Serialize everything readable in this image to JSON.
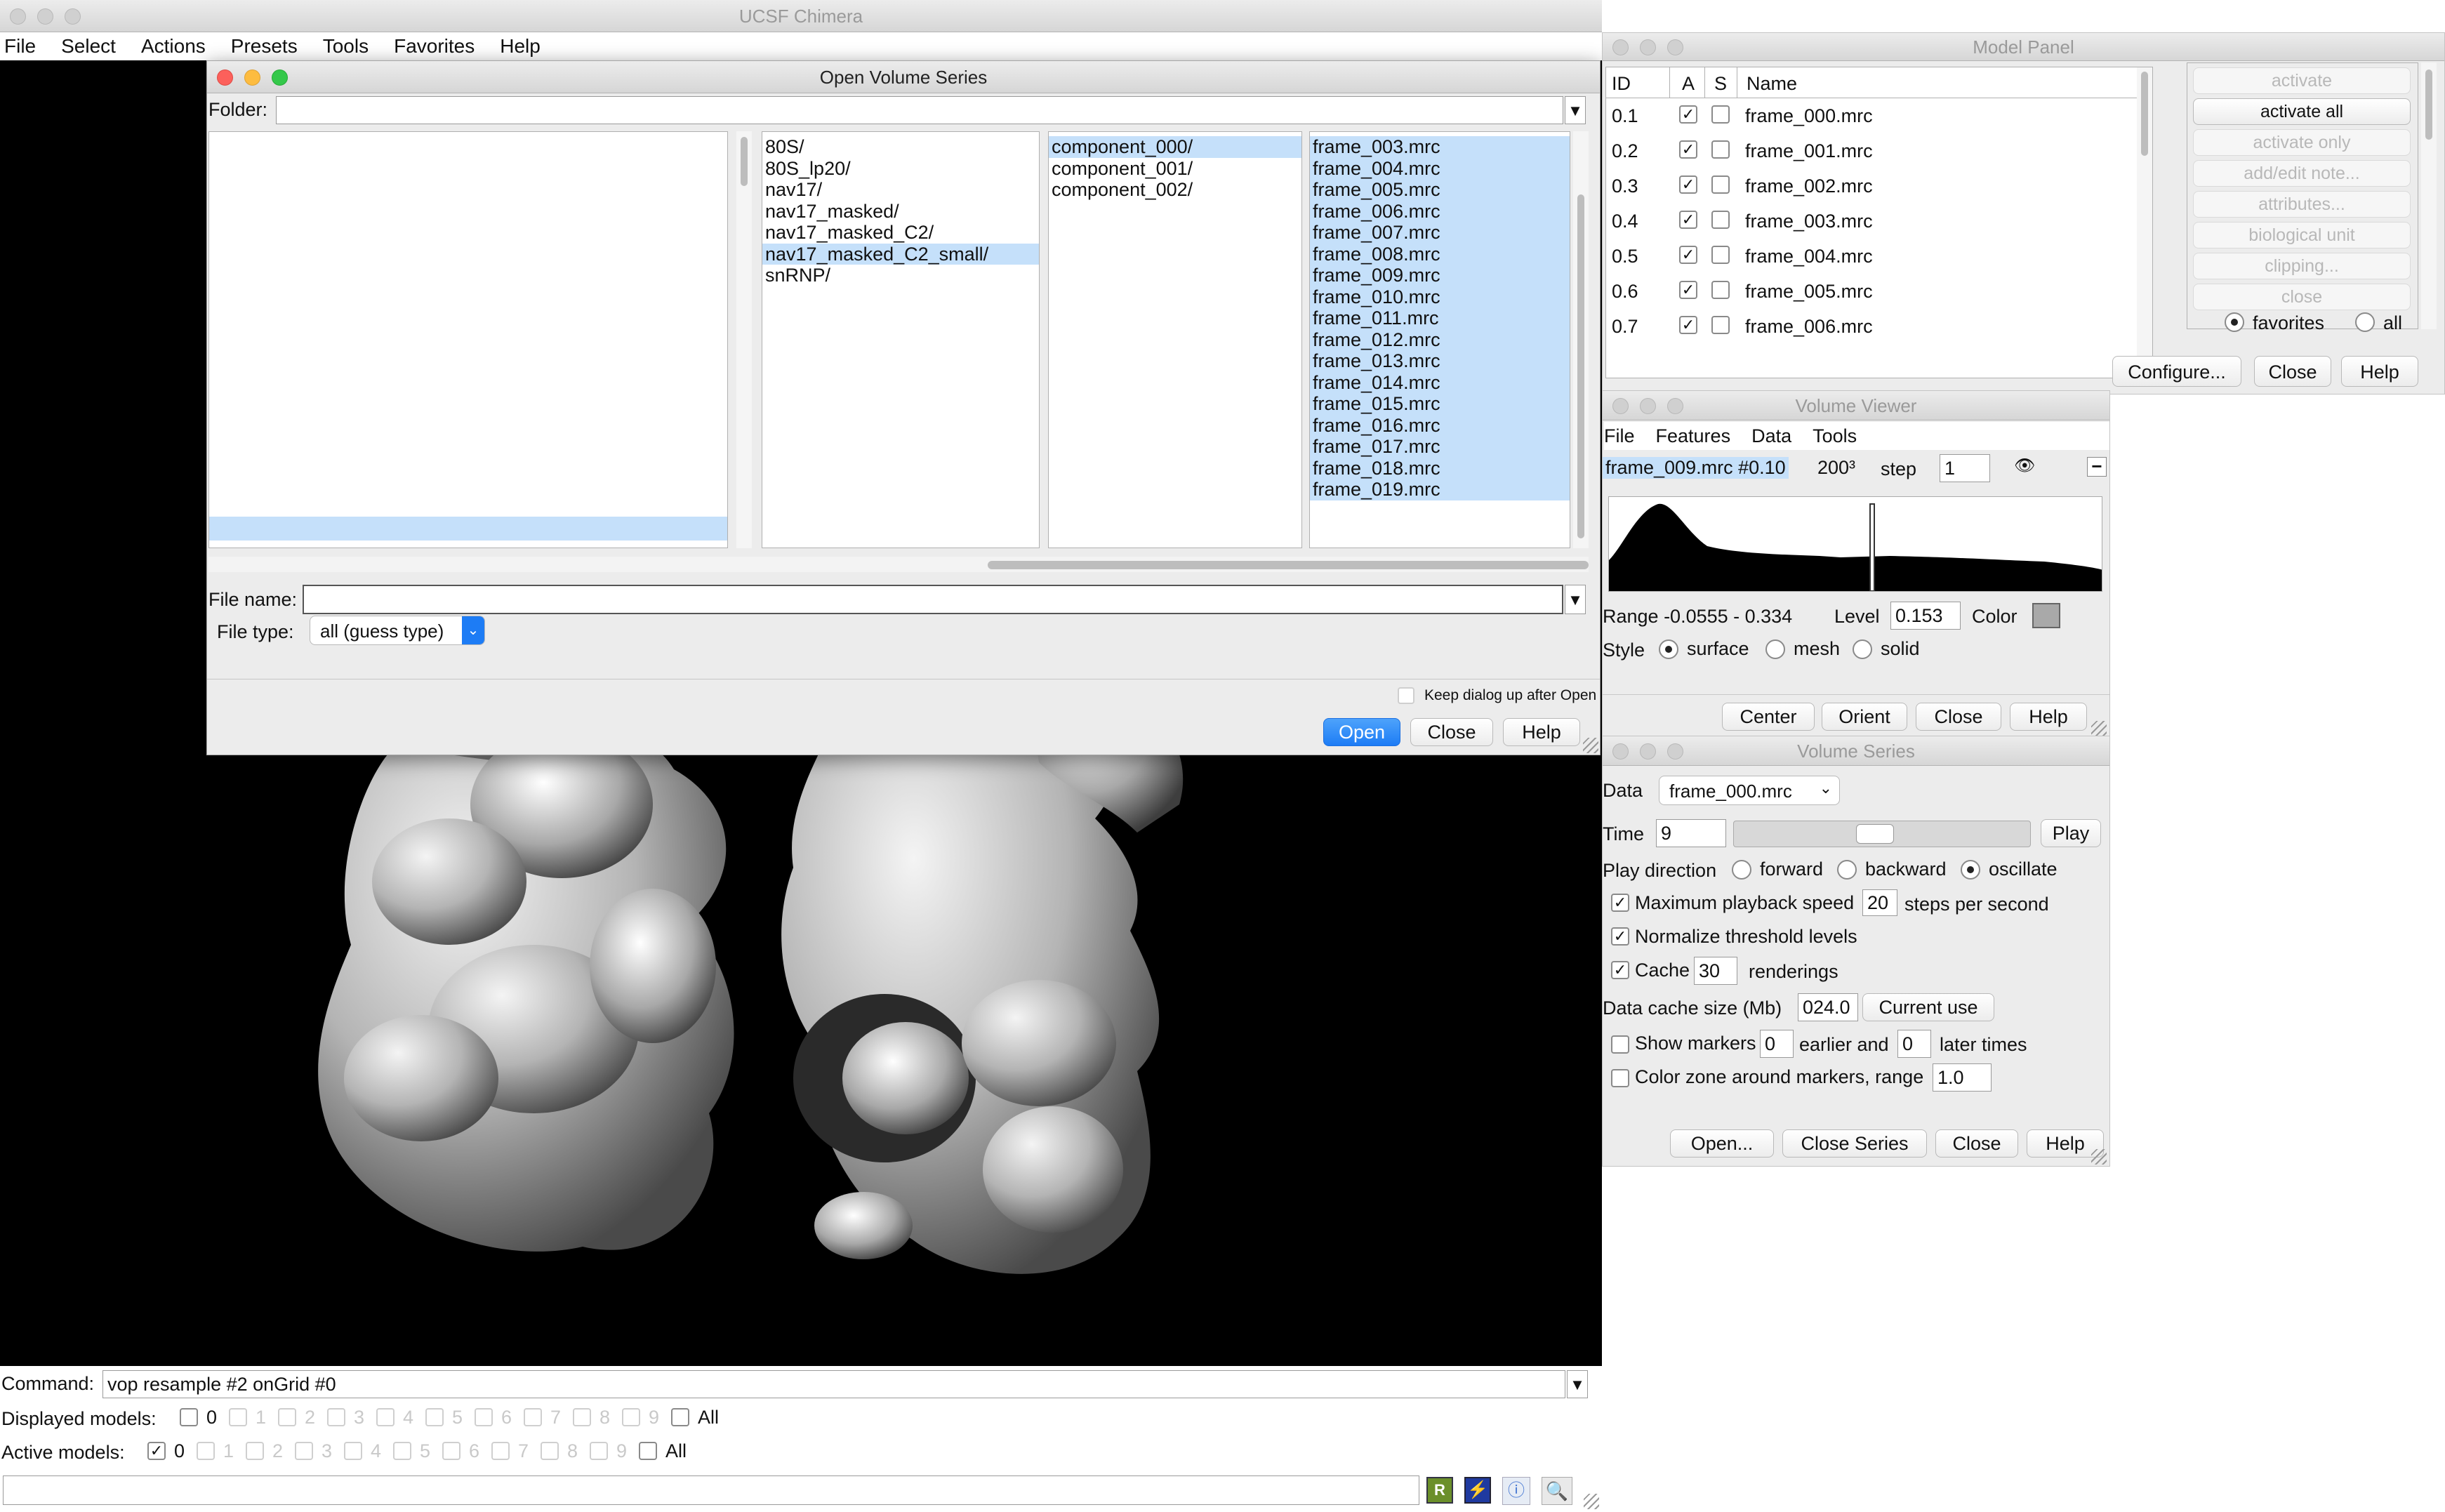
{
  "main": {
    "title": "UCSF Chimera",
    "menu": [
      "File",
      "Select",
      "Actions",
      "Presets",
      "Tools",
      "Favorites",
      "Help"
    ],
    "command_label": "Command:",
    "command_value": "vop resample #2 onGrid #0",
    "displayed_label": "Displayed models:",
    "active_label": "Active models:",
    "model_numbers": [
      "0",
      "1",
      "2",
      "3",
      "4",
      "5",
      "6",
      "7",
      "8",
      "9"
    ],
    "all_label": "All",
    "displayed_checked": [],
    "active_checked": [
      "0"
    ]
  },
  "open_dialog": {
    "title": "Open Volume Series",
    "folder_label": "Folder:",
    "folder_value": "",
    "col1": [
      "80S/",
      "80S_lp20/",
      "nav17/",
      "nav17_masked/",
      "nav17_masked_C2/",
      "nav17_masked_C2_small/",
      "snRNP/"
    ],
    "col1_selected": "nav17_masked_C2_small/",
    "col2": [
      "component_000/",
      "component_001/",
      "component_002/"
    ],
    "col2_selected": "component_000/",
    "col3": [
      "frame_003.mrc",
      "frame_004.mrc",
      "frame_005.mrc",
      "frame_006.mrc",
      "frame_007.mrc",
      "frame_008.mrc",
      "frame_009.mrc",
      "frame_010.mrc",
      "frame_011.mrc",
      "frame_012.mrc",
      "frame_013.mrc",
      "frame_014.mrc",
      "frame_015.mrc",
      "frame_016.mrc",
      "frame_017.mrc",
      "frame_018.mrc",
      "frame_019.mrc"
    ],
    "file_name_label": "File name:",
    "file_name_value": "",
    "file_type_label": "File type:",
    "file_type_value": "all (guess type)",
    "keep_label": "Keep dialog up after Open",
    "open_label": "Open",
    "close_label": "Close",
    "help_label": "Help"
  },
  "model_panel": {
    "title": "Model Panel",
    "headers": {
      "id": "ID",
      "a": "A",
      "s": "S",
      "name": "Name"
    },
    "rows": [
      {
        "id": "0.1",
        "name": "frame_000.mrc"
      },
      {
        "id": "0.2",
        "name": "frame_001.mrc"
      },
      {
        "id": "0.3",
        "name": "frame_002.mrc"
      },
      {
        "id": "0.4",
        "name": "frame_003.mrc"
      },
      {
        "id": "0.5",
        "name": "frame_004.mrc"
      },
      {
        "id": "0.6",
        "name": "frame_005.mrc"
      },
      {
        "id": "0.7",
        "name": "frame_006.mrc"
      }
    ],
    "actions": [
      "activate",
      "activate all",
      "activate only",
      "add/edit note...",
      "attributes...",
      "biological unit",
      "clipping...",
      "close"
    ],
    "favorites_label": "favorites",
    "all_label": "all",
    "configure_label": "Configure...",
    "close_label": "Close",
    "help_label": "Help"
  },
  "volume_viewer": {
    "title": "Volume Viewer",
    "menu": [
      "File",
      "Features",
      "Data",
      "Tools"
    ],
    "data_name": "frame_009.mrc #0.10",
    "size": "200³",
    "step_label": "step",
    "step_value": "1",
    "range_text": "Range  -0.0555 - 0.334",
    "level_label": "Level",
    "level_value": "0.153",
    "color_label": "Color",
    "style_label": "Style",
    "styles": [
      "surface",
      "mesh",
      "solid"
    ],
    "buttons": [
      "Center",
      "Orient",
      "Close",
      "Help"
    ]
  },
  "volume_series": {
    "title": "Volume Series",
    "data_label": "Data",
    "data_value": "frame_000.mrc",
    "time_label": "Time",
    "time_value": "9",
    "time_fraction": 0.47,
    "play_label": "Play",
    "direction_label": "Play direction",
    "directions": [
      "forward",
      "backward",
      "oscillate"
    ],
    "max_speed_label": "Maximum playback speed",
    "max_speed_value": "20",
    "steps_label": "steps per second",
    "normalize_label": "Normalize threshold levels",
    "cache_label": "Cache",
    "cache_value": "30",
    "renderings_label": "renderings",
    "cache_size_label": "Data cache size (Mb)",
    "cache_size_value": "024.0",
    "current_use_label": "Current use",
    "show_markers_label": "Show markers",
    "earlier_value": "0",
    "earlier_label": "earlier and",
    "later_value": "0",
    "later_label": "later times",
    "color_zone_label": "Color zone around markers, range",
    "color_zone_value": "1.0",
    "buttons": [
      "Open...",
      "Close Series",
      "Close",
      "Help"
    ]
  }
}
